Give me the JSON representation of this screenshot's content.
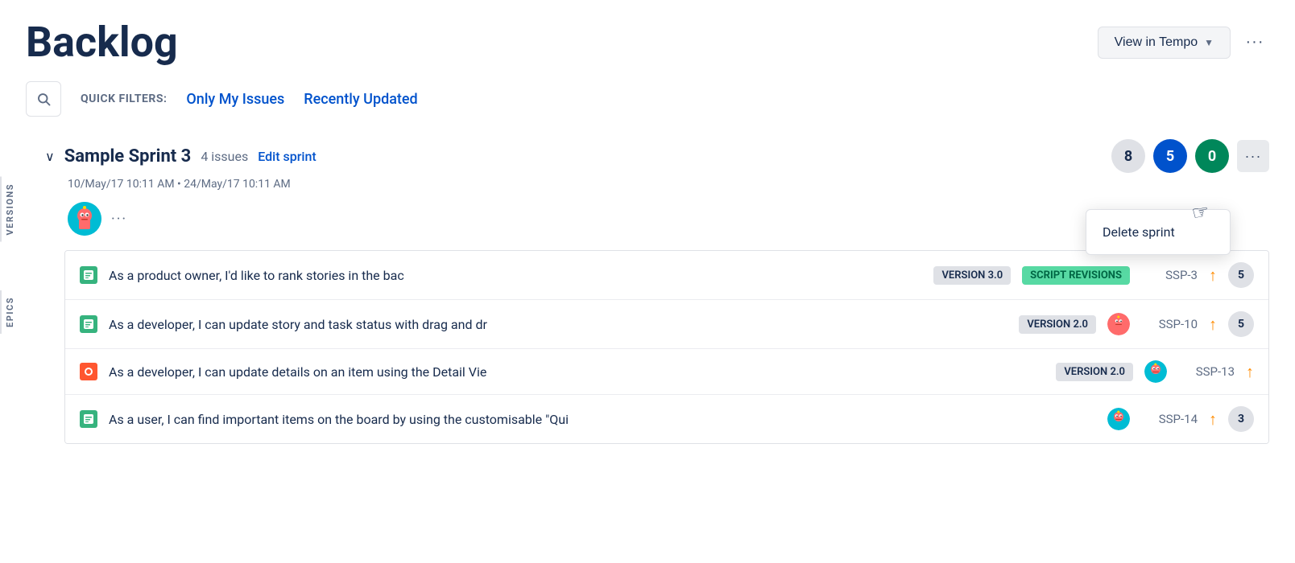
{
  "header": {
    "title": "Backlog",
    "view_in_tempo": "View in Tempo",
    "more_label": "···"
  },
  "filters": {
    "quick_filters_label": "QUICK FILTERS:",
    "only_my_issues": "Only My Issues",
    "recently_updated": "Recently Updated"
  },
  "side_labels": {
    "versions": "VERSIONS",
    "epics": "EPICS"
  },
  "sprint": {
    "name": "Sample Sprint 3",
    "issues_count": "4 issues",
    "edit_label": "Edit sprint",
    "dates": "10/May/17 10:11 AM • 24/May/17 10:11 AM",
    "badge_gray": "8",
    "badge_blue": "5",
    "badge_green": "0",
    "delete_label": "Delete sprint"
  },
  "issues": [
    {
      "id": "SSP-3",
      "type": "story",
      "summary": "As a product owner, I'd like to rank stories in the bac",
      "version": "VERSION 3.0",
      "epic": "SCRIPT REVISIONS",
      "priority": "↑",
      "points": "5",
      "has_avatar": false
    },
    {
      "id": "SSP-10",
      "type": "story",
      "summary": "As a developer, I can update story and task status with drag and dr",
      "version": "VERSION 2.0",
      "epic": null,
      "priority": "↑",
      "points": "5",
      "has_avatar": true
    },
    {
      "id": "SSP-13",
      "type": "bug",
      "summary": "As a developer, I can update details on an item using the Detail Vie",
      "version": "VERSION 2.0",
      "epic": null,
      "priority": "↑",
      "points": null,
      "has_avatar": true
    },
    {
      "id": "SSP-14",
      "type": "story",
      "summary": "As a user, I can find important items on the board by using the customisable \"Qui",
      "version": null,
      "epic": null,
      "priority": "↑",
      "points": "3",
      "has_avatar": true
    }
  ]
}
